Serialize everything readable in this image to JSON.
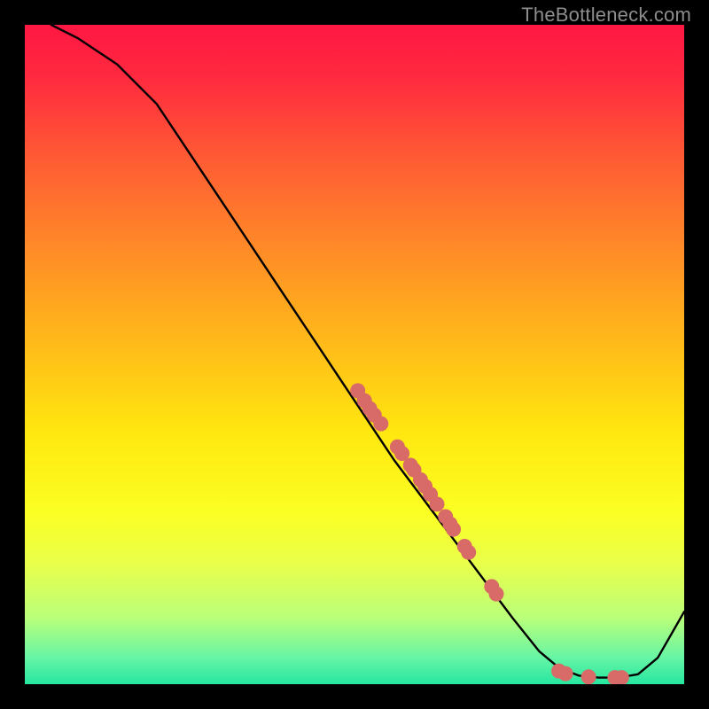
{
  "watermark": "TheBottleneck.com",
  "chart_data": {
    "type": "line",
    "title": "",
    "xlabel": "",
    "ylabel": "",
    "xlim": [
      0,
      100
    ],
    "ylim": [
      0,
      100
    ],
    "grid": false,
    "legend": null,
    "background_gradient": {
      "stops": [
        {
          "pos": 0.0,
          "color": "#ff1743"
        },
        {
          "pos": 0.08,
          "color": "#ff2a3f"
        },
        {
          "pos": 0.2,
          "color": "#ff5a34"
        },
        {
          "pos": 0.35,
          "color": "#ff8e26"
        },
        {
          "pos": 0.5,
          "color": "#ffc018"
        },
        {
          "pos": 0.62,
          "color": "#ffe80f"
        },
        {
          "pos": 0.74,
          "color": "#fbff23"
        },
        {
          "pos": 0.82,
          "color": "#e8ff4c"
        },
        {
          "pos": 0.9,
          "color": "#b9ff7a"
        },
        {
          "pos": 0.96,
          "color": "#66f5a5"
        },
        {
          "pos": 1.0,
          "color": "#26e6a0"
        }
      ]
    },
    "series": [
      {
        "name": "bottleneck-curve",
        "x": [
          4,
          8,
          14,
          20,
          26,
          32,
          38,
          44,
          50,
          56,
          62,
          68,
          74,
          78,
          81,
          84,
          87,
          90,
          93,
          96,
          100
        ],
        "y": [
          100,
          98,
          94,
          88,
          79,
          70,
          61,
          52,
          43,
          34,
          26,
          18,
          10,
          5,
          2.5,
          1.3,
          1.0,
          1.0,
          1.5,
          4,
          11
        ]
      }
    ],
    "scatter_points": {
      "name": "highlight-dots",
      "points": [
        {
          "x": 50.5,
          "y": 44.5
        },
        {
          "x": 51.5,
          "y": 43.0
        },
        {
          "x": 52.3,
          "y": 41.8
        },
        {
          "x": 53.0,
          "y": 40.8
        },
        {
          "x": 54.0,
          "y": 39.5
        },
        {
          "x": 56.5,
          "y": 36.0
        },
        {
          "x": 57.2,
          "y": 35.0
        },
        {
          "x": 58.5,
          "y": 33.2
        },
        {
          "x": 59.0,
          "y": 32.5
        },
        {
          "x": 60.0,
          "y": 31.0
        },
        {
          "x": 60.7,
          "y": 30.0
        },
        {
          "x": 61.5,
          "y": 28.8
        },
        {
          "x": 62.5,
          "y": 27.3
        },
        {
          "x": 63.8,
          "y": 25.4
        },
        {
          "x": 64.5,
          "y": 24.3
        },
        {
          "x": 65.0,
          "y": 23.5
        },
        {
          "x": 66.7,
          "y": 20.9
        },
        {
          "x": 67.3,
          "y": 20.0
        },
        {
          "x": 70.8,
          "y": 14.8
        },
        {
          "x": 71.5,
          "y": 13.7
        },
        {
          "x": 81.0,
          "y": 2.0
        },
        {
          "x": 82.0,
          "y": 1.6
        },
        {
          "x": 85.5,
          "y": 1.1
        },
        {
          "x": 89.5,
          "y": 1.0
        },
        {
          "x": 90.5,
          "y": 1.0
        }
      ]
    }
  }
}
